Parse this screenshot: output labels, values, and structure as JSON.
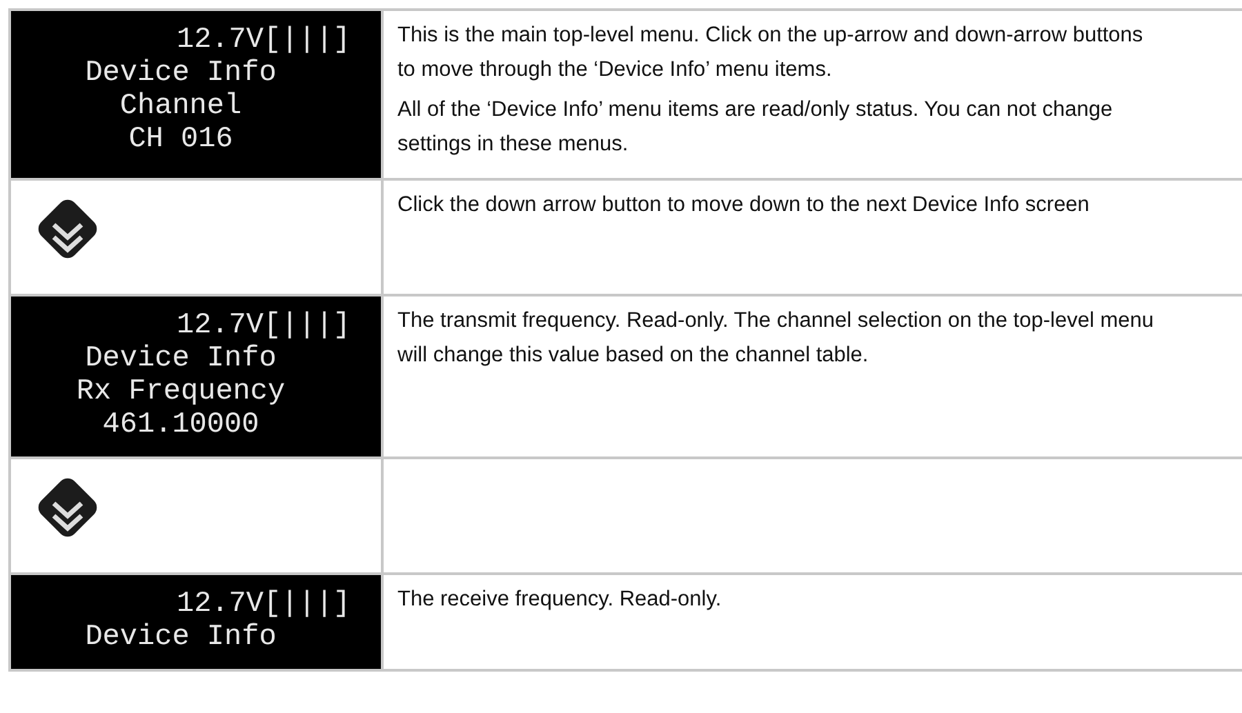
{
  "rows": [
    {
      "kind": "display",
      "display_lines": [
        "12.7V[|||]",
        "Device Info",
        "Channel",
        "CH 016"
      ],
      "description": [
        "This is the main top-level menu. Click on the up-arrow and down-arrow buttons to move through the ‘Device Info’ menu items.",
        "All of the ‘Device Info’ menu items are read/only status. You can not change settings in these menus."
      ]
    },
    {
      "kind": "down_button",
      "description": [
        "Click the down arrow button to move down to the next Device Info screen"
      ]
    },
    {
      "kind": "display",
      "display_lines": [
        "12.7V[|||]",
        "Device Info",
        "Rx Frequency",
        "461.10000"
      ],
      "description": [
        "The transmit frequency. Read-only. The channel selection on the top-level menu will change this value based on the channel table."
      ]
    },
    {
      "kind": "down_button"
    },
    {
      "kind": "display",
      "display_lines": [
        "12.7V[|||]",
        "Device Info"
      ],
      "description": [
        "The receive frequency. Read-only."
      ]
    }
  ]
}
